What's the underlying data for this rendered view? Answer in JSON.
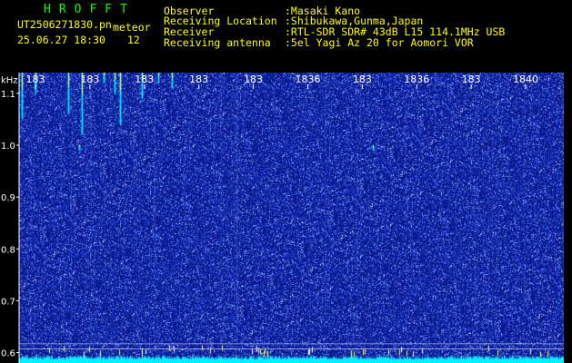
{
  "header": {
    "title": "HROFFT",
    "filename": "UT2506271830.pn",
    "mode": "meteor",
    "datetime": "25.06.27 18:30",
    "count": "12",
    "observer_label": "Observer",
    "observer_value": ":Masaki Kano",
    "location_label": "Receiving Location",
    "location_value": ":Shibukawa,Gunma,Japan",
    "receiver_label": "Receiver",
    "receiver_value": ":RTL-SDR SDR# 43dB L15 114.1MHz USB",
    "antenna_label": "Receiving antenna",
    "antenna_value": ":5el Yagi Az 20 for Aomori VOR"
  },
  "chart_data": {
    "type": "heatmap",
    "yunit": "kHz",
    "y_ticks": [
      "1.1",
      "1.0",
      "0.9",
      "0.8",
      "0.7",
      "0.6"
    ],
    "y_tick_values": [
      1.1,
      1.0,
      0.9,
      0.8,
      0.7,
      0.6
    ],
    "ylim": [
      0.58,
      1.14
    ],
    "x_ticks": [
      "183",
      "183",
      "183",
      "183",
      "183",
      "1836",
      "183",
      "1836",
      "183",
      "1840"
    ],
    "x_tick_minutes": [
      0.3,
      1.3,
      2.3,
      3.3,
      4.3,
      5.3,
      6.3,
      7.3,
      8.3,
      9.3
    ],
    "xlim": [
      0,
      10
    ],
    "colors": {
      "background": "#0b1a8c",
      "noise": "#4f6cff",
      "signal": "#00f0ff",
      "echo": "#ffff40",
      "grid": "#ffffff"
    },
    "carrier_khz": 0.595,
    "reference_lines_khz": [
      0.617,
      0.607
    ],
    "meteor_echoes": [
      {
        "minute": 0.05,
        "khz_top": 1.14,
        "khz_bottom": 1.05
      },
      {
        "minute": 0.3,
        "khz_top": 1.14,
        "khz_bottom": 1.1
      },
      {
        "minute": 0.9,
        "khz_top": 1.14,
        "khz_bottom": 1.06
      },
      {
        "minute": 1.15,
        "khz_top": 1.14,
        "khz_bottom": 1.02
      },
      {
        "minute": 1.55,
        "khz_top": 1.14,
        "khz_bottom": 1.12
      },
      {
        "minute": 1.75,
        "khz_top": 1.14,
        "khz_bottom": 1.1
      },
      {
        "minute": 1.85,
        "khz_top": 1.14,
        "khz_bottom": 1.04
      },
      {
        "minute": 2.25,
        "khz_top": 1.14,
        "khz_bottom": 1.09
      },
      {
        "minute": 2.55,
        "khz_top": 1.14,
        "khz_bottom": 1.12
      },
      {
        "minute": 2.8,
        "khz_top": 1.14,
        "khz_bottom": 1.11
      },
      {
        "minute": 1.1,
        "khz_top": 1.0,
        "khz_bottom": 0.99
      },
      {
        "minute": 6.5,
        "khz_top": 1.0,
        "khz_bottom": 0.99
      }
    ]
  }
}
